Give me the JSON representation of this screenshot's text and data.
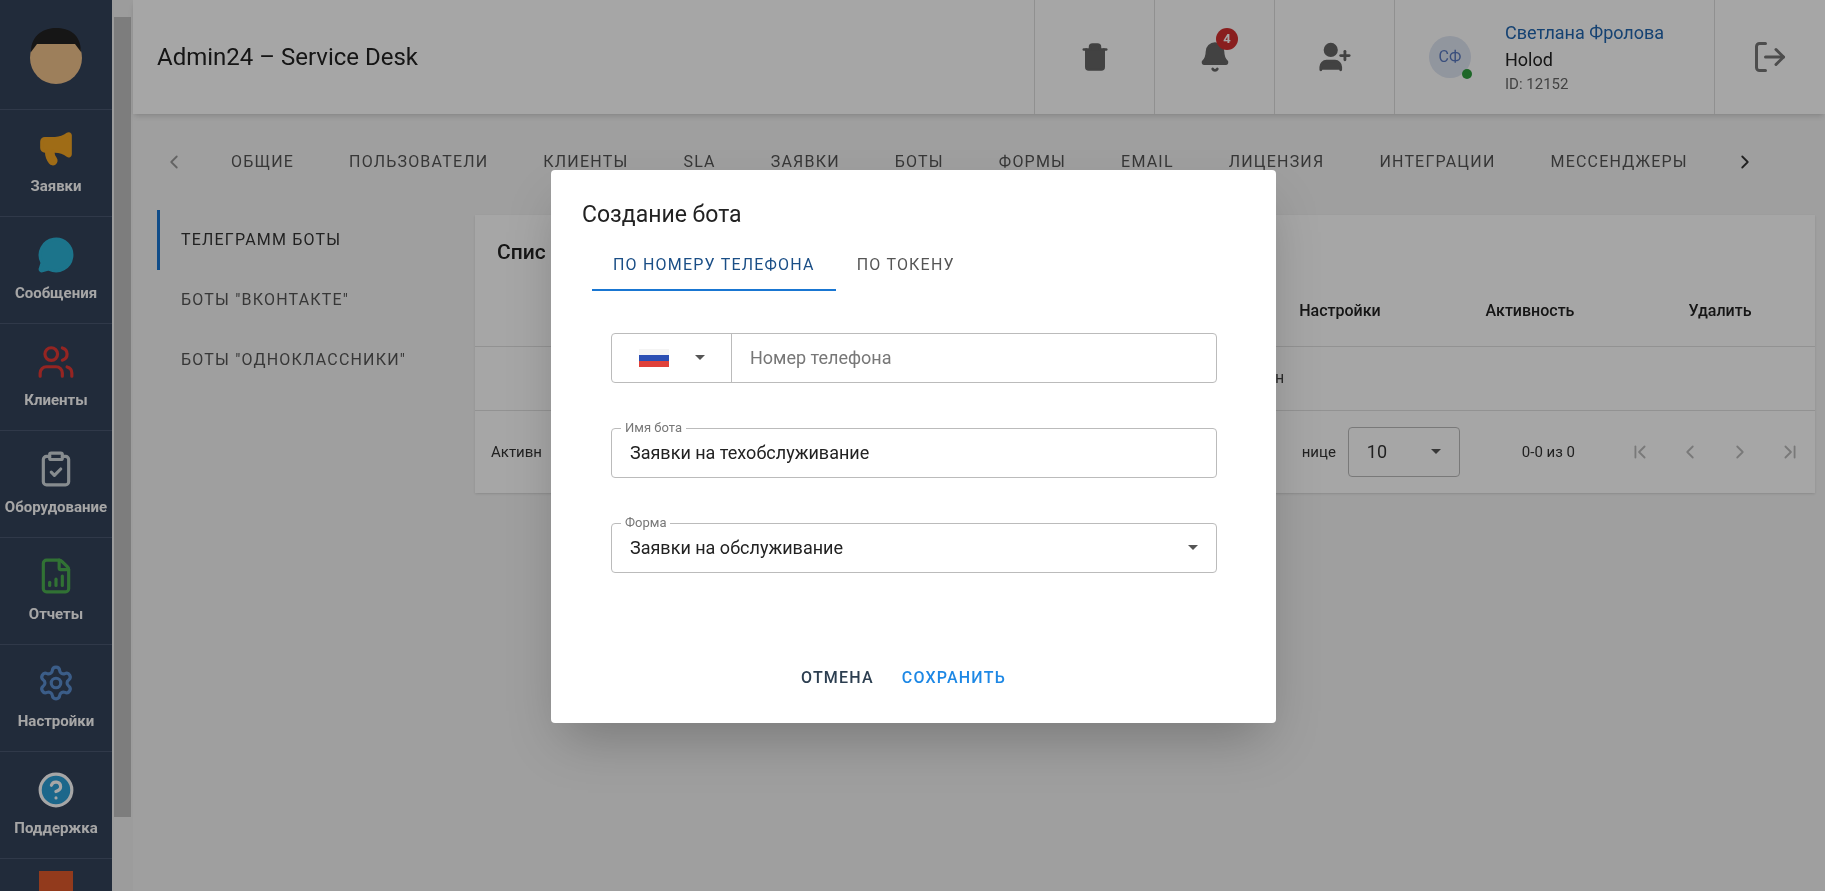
{
  "sidebar": {
    "items": [
      {
        "label": "Заявки"
      },
      {
        "label": "Сообщения"
      },
      {
        "label": "Клиенты"
      },
      {
        "label": "Оборудование"
      },
      {
        "label": "Отчеты"
      },
      {
        "label": "Настройки"
      },
      {
        "label": "Поддержка"
      }
    ]
  },
  "header": {
    "title": "Admin24 – Service Desk",
    "notifications": "4",
    "user": {
      "name": "Светлана Фролова",
      "company": "Holod",
      "id": "ID: 12152",
      "initials": "СФ",
      "online": true
    }
  },
  "tabs": [
    {
      "label": "ОБЩИЕ"
    },
    {
      "label": "ПОЛЬЗОВАТЕЛИ"
    },
    {
      "label": "КЛИЕНТЫ"
    },
    {
      "label": "SLA"
    },
    {
      "label": "ЗАЯВКИ"
    },
    {
      "label": "БОТЫ"
    },
    {
      "label": "ФОРМЫ"
    },
    {
      "label": "EMAIL"
    },
    {
      "label": "ЛИЦЕНЗИЯ"
    },
    {
      "label": "ИНТЕГРАЦИИ"
    },
    {
      "label": "МЕССЕНДЖЕРЫ"
    }
  ],
  "side_tabs": [
    {
      "label": "ТЕЛЕГРАММ БОТЫ",
      "selected": true
    },
    {
      "label": "БОТЫ \"ВКОНТАКТЕ\"",
      "selected": false
    },
    {
      "label": "БОТЫ \"ОДНОКЛАССНИКИ\"",
      "selected": false
    }
  ],
  "card": {
    "title": "Спис",
    "columns": [
      "Настройки",
      "Активность",
      "Удалить"
    ],
    "row_text": "н",
    "footer_left": "Активн",
    "rows_label": "нице",
    "rows_per_page": "10",
    "range": "0-0 из 0"
  },
  "dialog": {
    "title": "Создание бота",
    "tabs": [
      {
        "label": "ПО НОМЕРУ ТЕЛЕФОНА",
        "selected": true
      },
      {
        "label": "ПО ТОКЕНУ",
        "selected": false
      }
    ],
    "phone": {
      "placeholder": "Номер телефона"
    },
    "bot_name": {
      "label": "Имя бота",
      "value": "Заявки на техобслуживание"
    },
    "form": {
      "label": "Форма",
      "value": "Заявки на обслуживание"
    },
    "buttons": [
      {
        "label": "ОТМЕНА",
        "kind": "secondary"
      },
      {
        "label": "СОХРАНИТЬ",
        "kind": "primary"
      }
    ]
  }
}
